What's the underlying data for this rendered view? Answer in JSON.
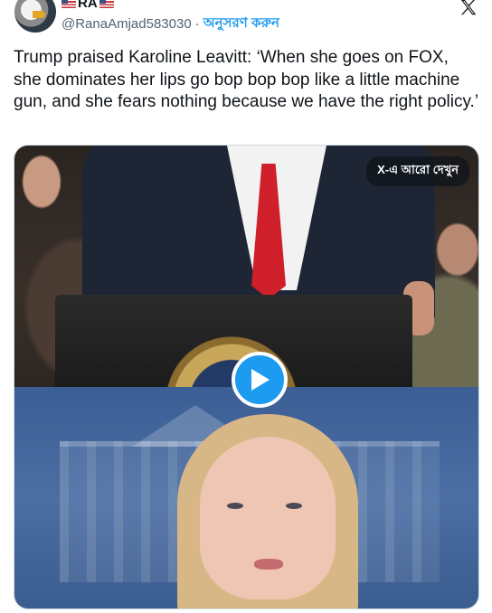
{
  "author": {
    "display_name": "RA",
    "handle": "@RanaAmjad583030",
    "separator": "·",
    "follow_label": "অনুসরণ করুন"
  },
  "tweet": {
    "text": "Trump praised Karoline Leavitt: ‘When she goes on FOX, she dominates her lips go bop bop bop like a little machine gun, and she fears nothing because we have the right policy.’"
  },
  "media": {
    "see_more_label": "X-এ আরো দেখুন",
    "play_icon": "play-icon"
  },
  "colors": {
    "accent": "#1d9bf0",
    "text": "#0f1419",
    "secondary": "#536471"
  }
}
